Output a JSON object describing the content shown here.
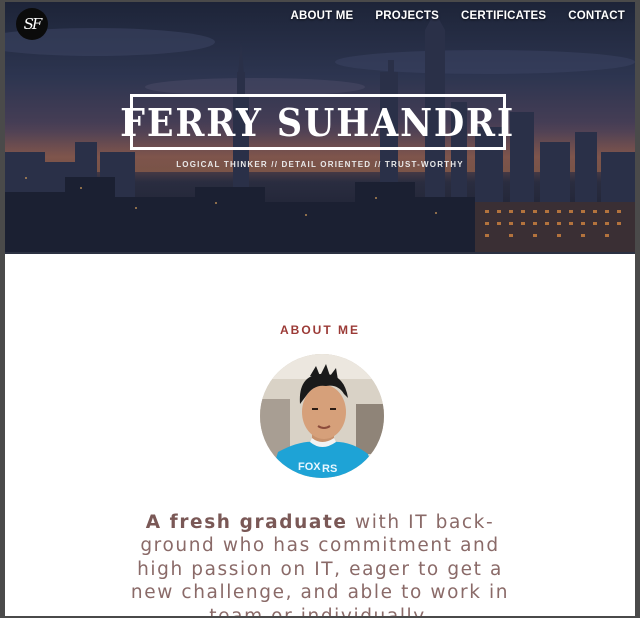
{
  "logo": {
    "text": "SF"
  },
  "nav": {
    "items": [
      {
        "label": "ABOUT ME"
      },
      {
        "label": "PROJECTS"
      },
      {
        "label": "CERTIFICATES"
      },
      {
        "label": "CONTACT"
      }
    ]
  },
  "hero": {
    "name": "FERRY SUHANDRI",
    "tagline": "LOGICAL THINKER // DETAIL ORIENTED // TRUST-WORTHY"
  },
  "about": {
    "heading": "ABOUT ME",
    "intro_bold": "A fresh graduate",
    "intro_rest": " with IT back-ground who has commitment and high passion on IT, eager to get a new challenge, and able to work in team or individually."
  },
  "colors": {
    "accent": "#9b3a36",
    "body_text": "#8a6a68"
  }
}
